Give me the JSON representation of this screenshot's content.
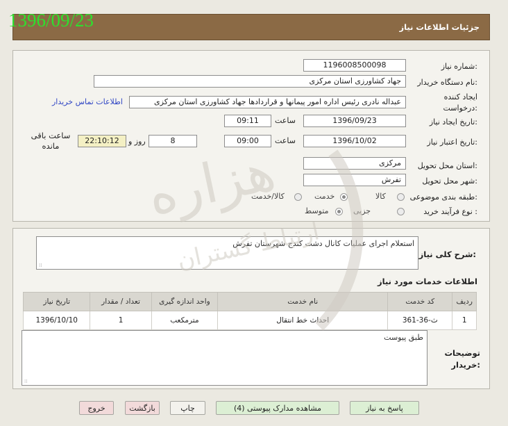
{
  "date_stamp": "1396/09/23",
  "header": {
    "title": "جزئیات اطلاعات نیاز"
  },
  "form": {
    "need_number_label": "شماره نیاز:",
    "need_number": "1196008500098",
    "buyer_org_label": "نام دستگاه خریدار:",
    "buyer_org": "جهاد کشاورزی استان مرکزی",
    "requester_label": "ایجاد کننده درخواست:",
    "requester": "عبداله نادری رئیس اداره امور پیمانها و قراردادها جهاد کشاورزی استان مرکزی",
    "contact_link": "اطلاعات تماس خریدار",
    "created_label": "تاریخ ایجاد نیاز:",
    "created_date": "1396/09/23",
    "time_label": "ساعت",
    "created_time": "09:11",
    "validity_label": "تاریخ اعتبار نیاز:",
    "validity_date": "1396/10/02",
    "validity_time": "09:00",
    "days_left": "8",
    "days_and_label": "روز و",
    "remaining_time": "22:10:12",
    "remaining_label": "ساعت باقی مانده",
    "province_label": "استان محل تحویل:",
    "province": "مرکزی",
    "city_label": "شهر محل تحویل:",
    "city": "تفرش",
    "category_label": "طبقه بندی موضوعی:",
    "category_options": [
      "کالا",
      "خدمت",
      "کالا/خدمت"
    ],
    "category_selected": "خدمت",
    "process_label": "نوع فرآیند خرید :",
    "process_options": [
      "جزیی",
      "متوسط"
    ],
    "process_selected": "متوسط"
  },
  "summary": {
    "label": "شرح کلی نیاز:",
    "text": "استعلام اجرای عملیات کانال دشت کندج شهرستان تفرش"
  },
  "services": {
    "title": "اطلاعات خدمات مورد نیاز",
    "columns": [
      "ردیف",
      "کد خدمت",
      "نام خدمت",
      "واحد اندازه گیری",
      "تعداد / مقدار",
      "تاریخ نیاز"
    ],
    "rows": [
      {
        "index": "1",
        "code": "ث-36-361",
        "name": "احداث خط انتقال",
        "unit": "مترمکعب",
        "qty": "1",
        "date": "1396/10/10"
      }
    ]
  },
  "buyer_notes": {
    "label": "توضیحات خریدار:",
    "text": "طبق پیوست"
  },
  "buttons": {
    "reply": "پاسخ به نیاز",
    "attachments": "مشاهده مدارک پیوستی (4)",
    "print": "چاپ",
    "back": "بازگشت",
    "exit": "خروج"
  },
  "watermark_text": [
    "هزاره",
    "ارتباط گستران"
  ],
  "colors": {
    "header": "#8b6a45",
    "stamp": "#2ee02e",
    "link": "#2f45c4"
  }
}
